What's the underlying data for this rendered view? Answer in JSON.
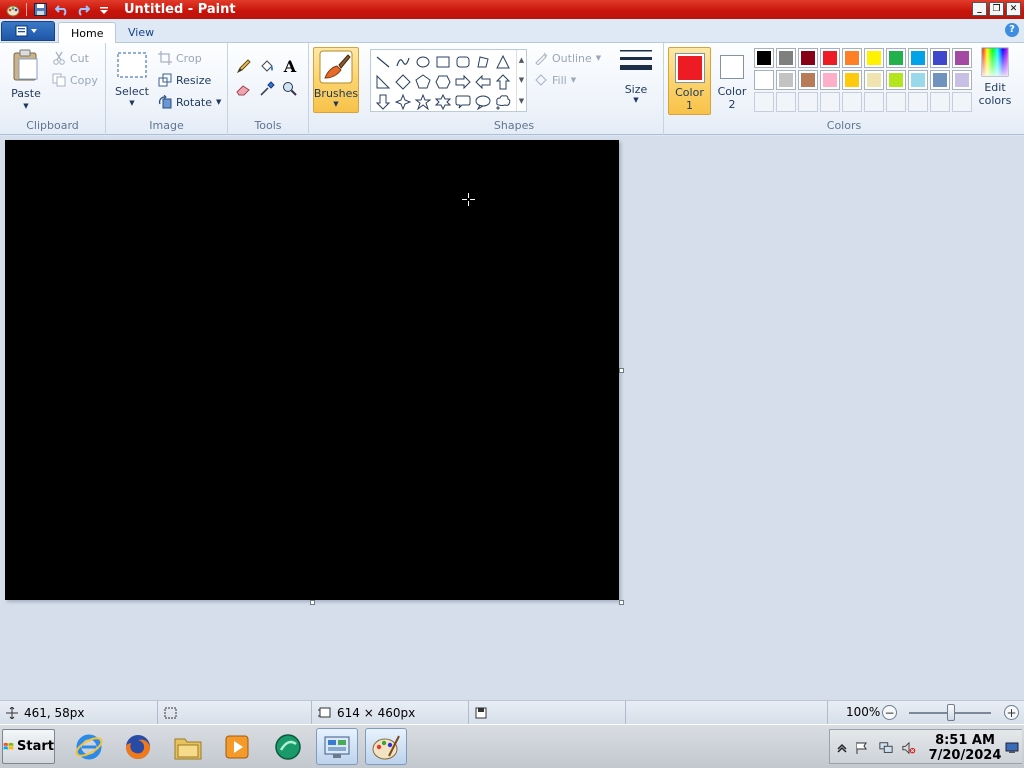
{
  "window": {
    "title": "Untitled - Paint",
    "buttons": {
      "minimize": "_",
      "restore": "❐",
      "close": "✕"
    }
  },
  "tabs": [
    "Home",
    "View"
  ],
  "active_tab": "Home",
  "help_label": "?",
  "clipboard": {
    "label": "Clipboard",
    "paste": "Paste",
    "cut": "Cut",
    "copy": "Copy"
  },
  "image": {
    "label": "Image",
    "select": "Select",
    "crop": "Crop",
    "resize": "Resize",
    "rotate": "Rotate"
  },
  "tools": {
    "label": "Tools",
    "items": [
      "pencil-icon",
      "fill-icon",
      "text-icon",
      "eraser-icon",
      "color-picker-icon",
      "magnifier-icon"
    ],
    "text_glyph": "A"
  },
  "brushes": {
    "label": "Brushes"
  },
  "shapes": {
    "label": "Shapes",
    "outline": "Outline",
    "fill": "Fill",
    "items": [
      "line",
      "curve",
      "oval",
      "rectangle",
      "rounded-rectangle",
      "polygon",
      "triangle",
      "right-triangle",
      "diamond",
      "pentagon",
      "hexagon",
      "right-arrow",
      "left-arrow",
      "up-arrow",
      "down-arrow",
      "four-point-star",
      "five-point-star",
      "six-point-star",
      "rounded-callout",
      "oval-callout",
      "cloud-callout"
    ]
  },
  "size": {
    "label": "Size"
  },
  "colors": {
    "label": "Colors",
    "color1_label_a": "Color",
    "color1_label_b": "1",
    "color2_label_a": "Color",
    "color2_label_b": "2",
    "color1": "#ed1c24",
    "color2": "#ffffff",
    "edit_a": "Edit",
    "edit_b": "colors",
    "palette_row1": [
      "#000000",
      "#7f7f7f",
      "#880015",
      "#ed1c24",
      "#ff7f27",
      "#fff200",
      "#22b14c",
      "#00a2e8",
      "#3f48cc",
      "#a349a4"
    ],
    "palette_row2": [
      "#ffffff",
      "#c3c3c3",
      "#b97a57",
      "#ffaec9",
      "#ffc90e",
      "#efe4b0",
      "#b5e61d",
      "#99d9ea",
      "#7092be",
      "#c8bfe7"
    ],
    "palette_row3_empty": 10
  },
  "canvas": {
    "fill": "#000000"
  },
  "status": {
    "cursor_pos": "461, 58px",
    "selection_size": "",
    "canvas_size": "614 × 460px",
    "zoom": "100%",
    "zoom_minus": "−",
    "zoom_plus": "+"
  },
  "taskbar": {
    "start": "Start",
    "apps": [
      "internet-explorer-icon",
      "firefox-icon",
      "file-explorer-icon",
      "media-player-icon",
      "green-app-icon",
      "control-panel-icon",
      "paint-icon"
    ],
    "time": "8:51 AM",
    "date": "7/20/2024"
  }
}
